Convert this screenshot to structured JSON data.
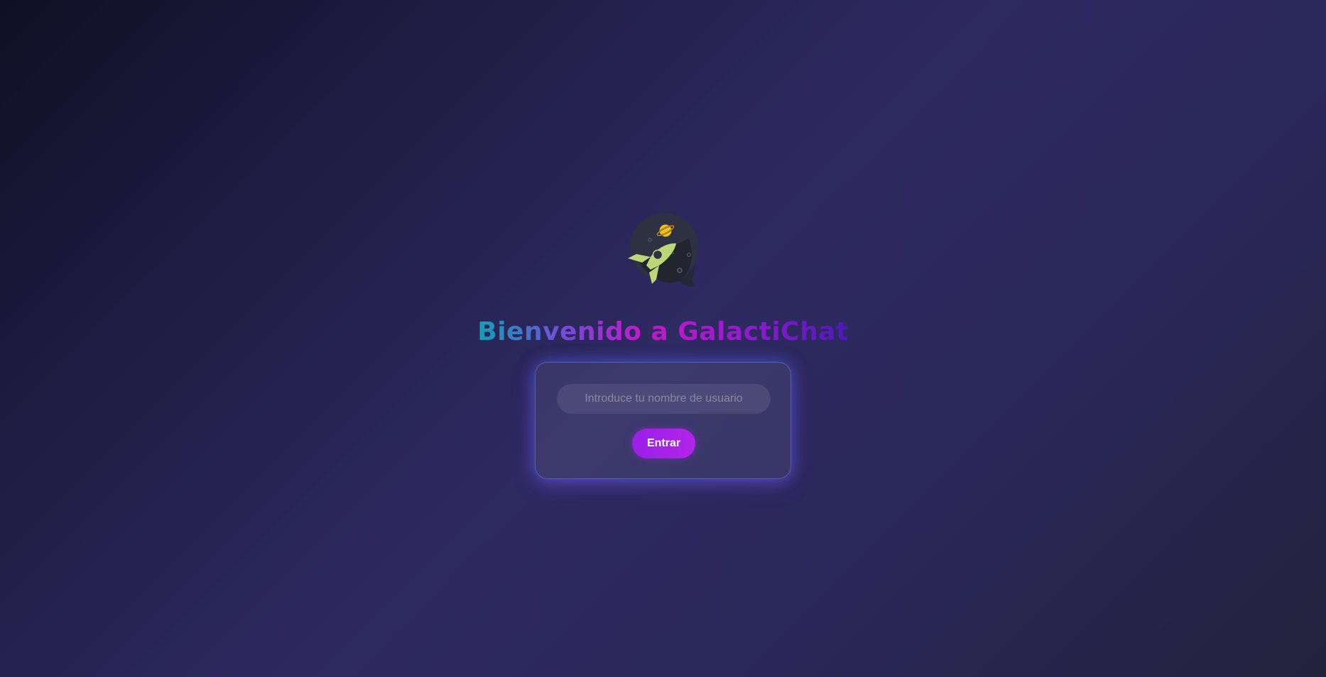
{
  "welcome": {
    "title": "Bienvenido a GalactiChat",
    "logo_icon": "rocket-chat-bubble-icon"
  },
  "login": {
    "username_placeholder": "Introduce tu nombre de usuario",
    "username_value": "",
    "enter_label": "Entrar"
  },
  "colors": {
    "accent": "#a322e8",
    "title_gradient_start": "#12a0b8",
    "title_gradient_mid": "#c21ac8",
    "title_gradient_end": "#4a1ab8",
    "background_dark": "#100f24",
    "background_mid": "#2e2a62"
  }
}
